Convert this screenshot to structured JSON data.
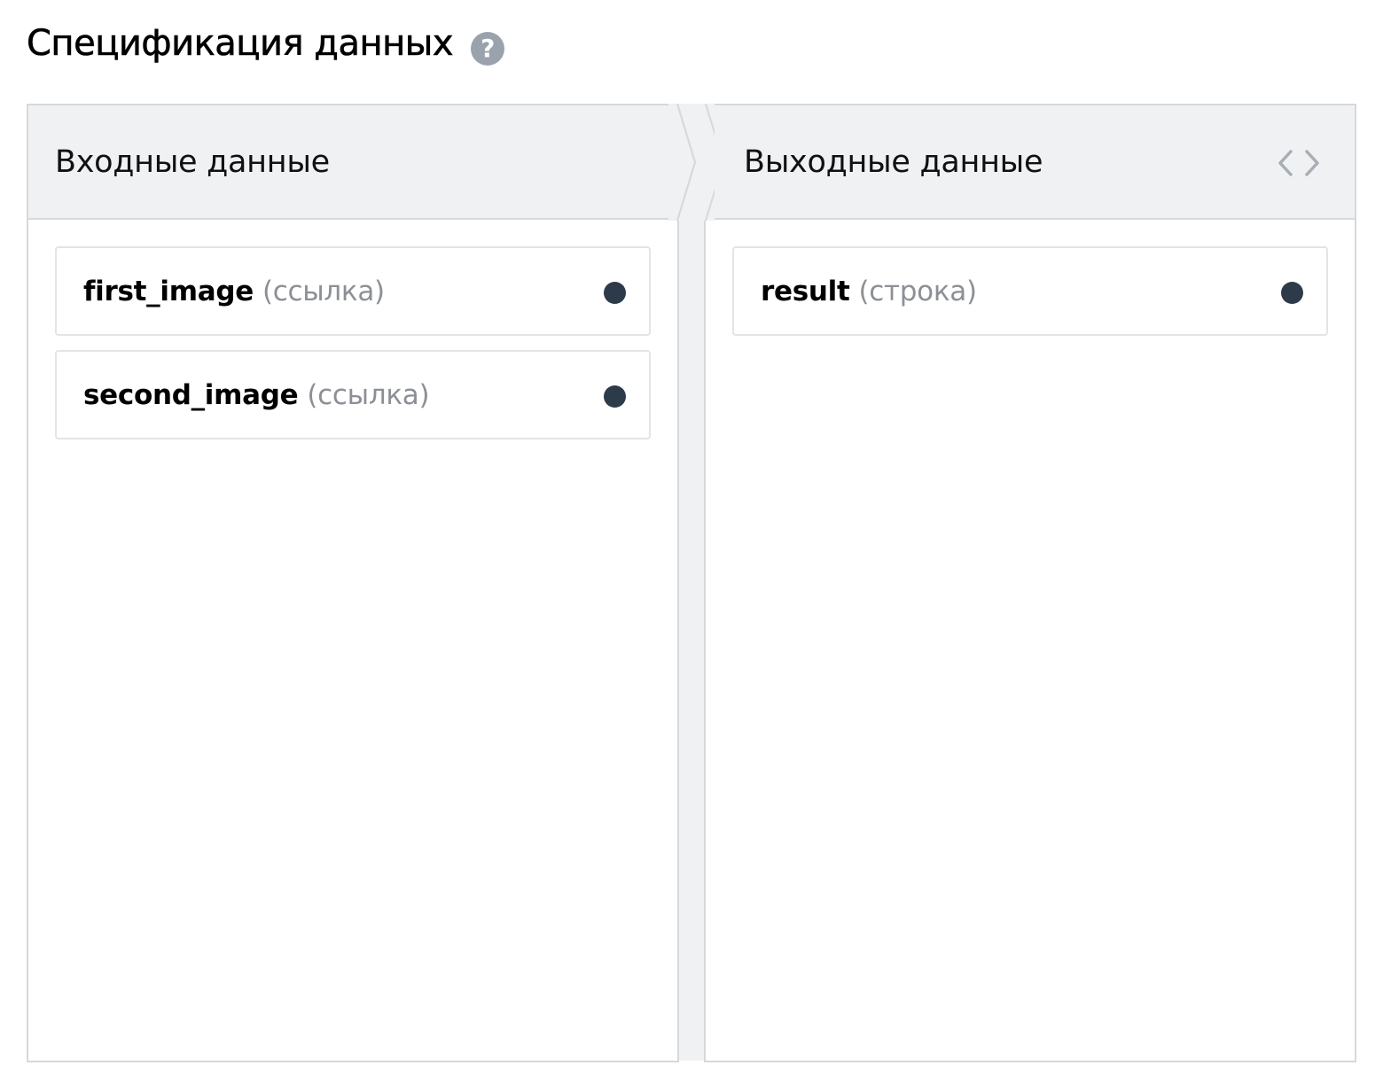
{
  "page": {
    "title": "Спецификация данных",
    "help_icon": "question-mark-icon",
    "help_glyph": "?"
  },
  "input": {
    "title": "Входные данные",
    "fields": [
      {
        "name": "first_image",
        "type": "(ссылка)"
      },
      {
        "name": "second_image",
        "type": "(ссылка)"
      }
    ]
  },
  "output": {
    "title": "Выходные данные",
    "code_toggle_icon": "code-brackets-icon",
    "fields": [
      {
        "name": "result",
        "type": "(строка)"
      }
    ]
  },
  "colors": {
    "header_bg": "#f0f1f3",
    "border": "#d6d8db",
    "dot": "#2c3a4a",
    "help_icon_bg": "#9aa3ad",
    "type_text": "#8c9096"
  }
}
